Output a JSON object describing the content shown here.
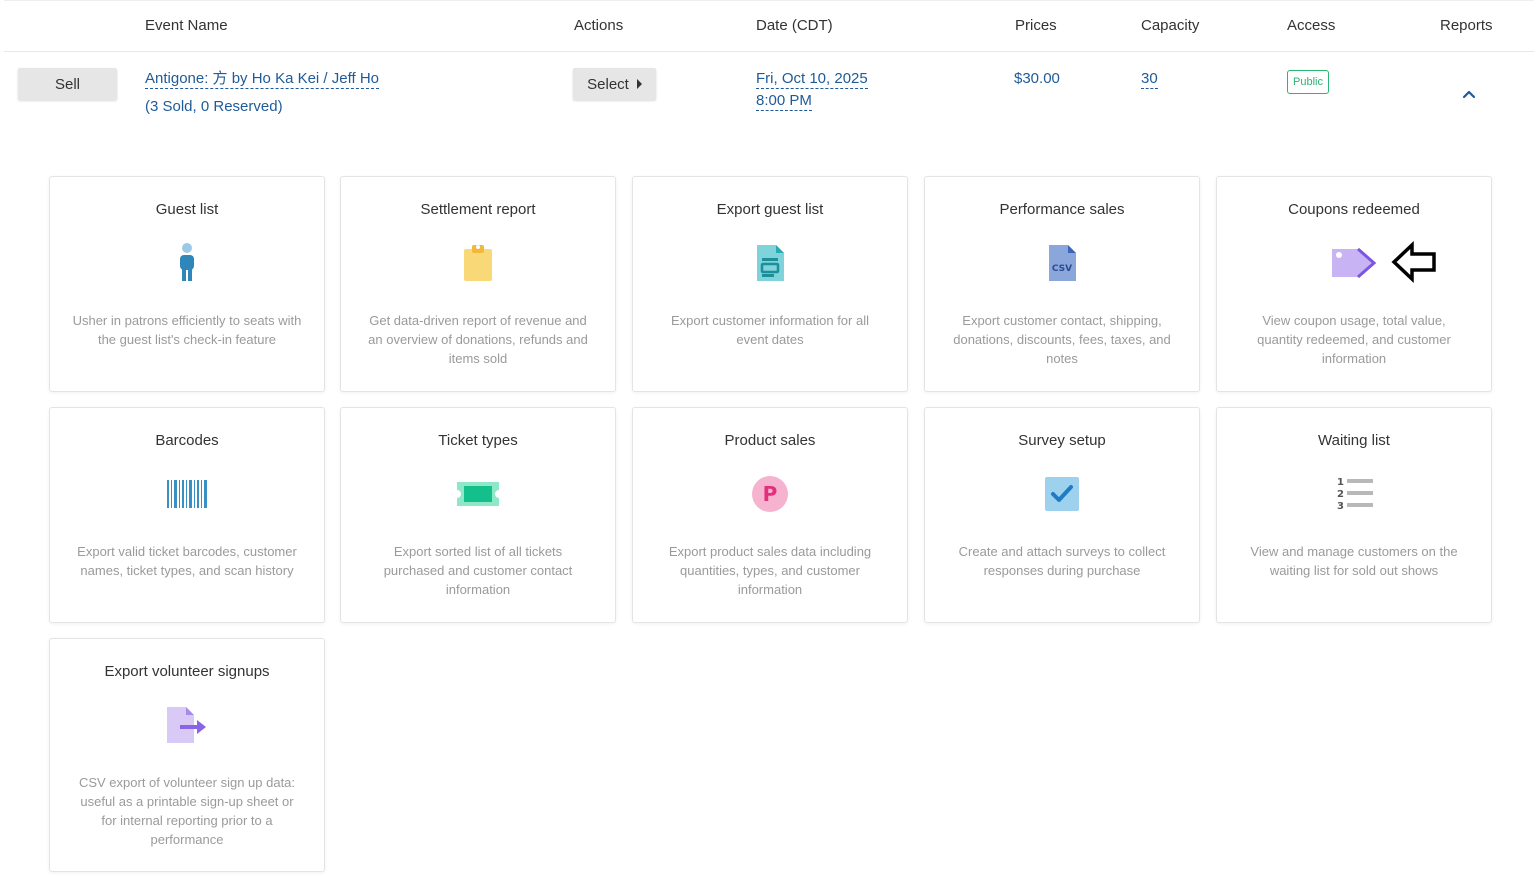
{
  "header": {
    "event_name": "Event Name",
    "actions": "Actions",
    "date": "Date (CDT)",
    "prices": "Prices",
    "capacity": "Capacity",
    "access": "Access",
    "reports": "Reports"
  },
  "event": {
    "sell_label": "Sell",
    "name": "Antigone: 方 by Ho Ka Kei / Jeff Ho",
    "sold": "(3 Sold, 0 Reserved)",
    "select_label": "Select",
    "date_line1": "Fri, Oct 10, 2025",
    "date_line2": "8:00 PM",
    "price": "$30.00",
    "capacity": "30",
    "access": "Public"
  },
  "cards": [
    {
      "title": "Guest list",
      "desc": "Usher in patrons efficiently to seats with the guest list's check-in feature",
      "icon": "person-icon"
    },
    {
      "title": "Settlement report",
      "desc": "Get data-driven report of revenue and an overview of donations, refunds and items sold",
      "icon": "clipboard-icon"
    },
    {
      "title": "Export guest list",
      "desc": "Export customer information for all event dates",
      "icon": "document-export-icon"
    },
    {
      "title": "Performance sales",
      "desc": "Export customer contact, shipping, donations, discounts, fees, taxes, and notes",
      "icon": "csv-file-icon"
    },
    {
      "title": "Coupons redeemed",
      "desc": "View coupon usage, total value, quantity redeemed, and customer information",
      "icon": "tag-icon"
    },
    {
      "title": "Barcodes",
      "desc": "Export valid ticket barcodes, customer names, ticket types, and scan history",
      "icon": "barcode-icon"
    },
    {
      "title": "Ticket types",
      "desc": "Export sorted list of all tickets purchased and customer contact information",
      "icon": "ticket-icon"
    },
    {
      "title": "Product sales",
      "desc": "Export product sales data including quantities, types, and customer information",
      "icon": "product-p-icon"
    },
    {
      "title": "Survey setup",
      "desc": "Create and attach surveys to collect responses during purchase",
      "icon": "checkbox-icon"
    },
    {
      "title": "Waiting list",
      "desc": "View and manage customers on the waiting list for sold out shows",
      "icon": "numbered-list-icon"
    },
    {
      "title": "Export volunteer signups",
      "desc": "CSV export of volunteer sign up data: useful as a printable sign-up sheet or for internal reporting prior to a performance",
      "icon": "file-export-icon"
    }
  ],
  "colors": {
    "link": "#1f5b98",
    "public_badge": "#2ab573",
    "desc_text": "#9a9a9a"
  }
}
